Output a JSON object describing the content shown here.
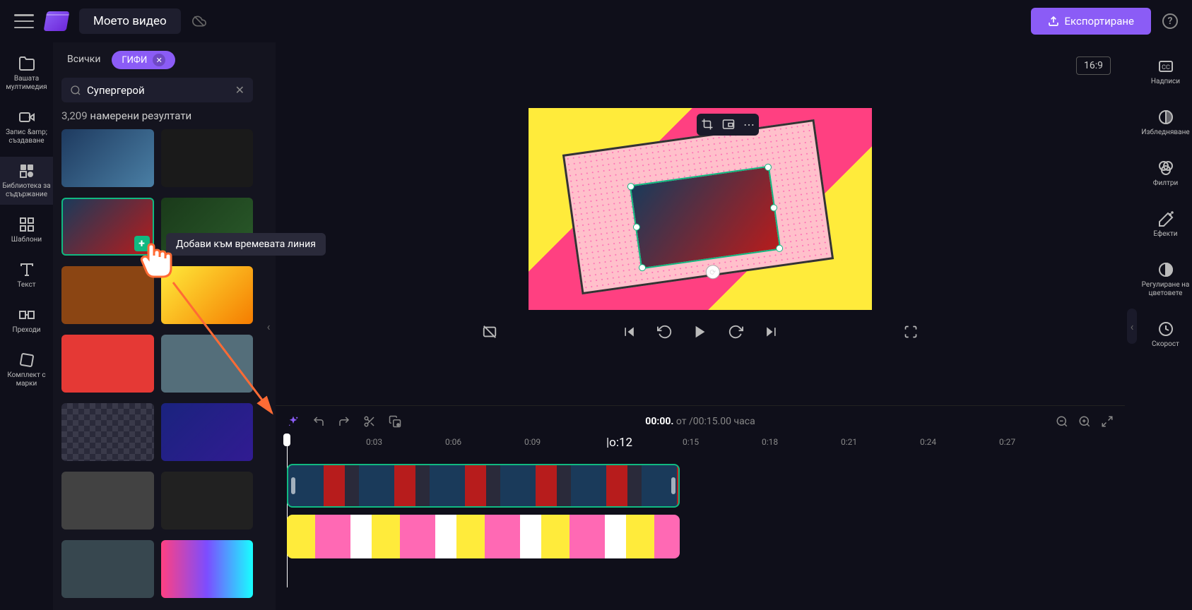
{
  "header": {
    "project_title": "Моето видео",
    "export_label": "Експортиране",
    "aspect_ratio": "16:9"
  },
  "left_nav": {
    "items": [
      {
        "icon": "folder",
        "label": "Вашата мултимедия"
      },
      {
        "icon": "camera",
        "label": "Запис &amp; създаване"
      },
      {
        "icon": "library",
        "label": "Библиотека за съдържание"
      },
      {
        "icon": "templates",
        "label": "Шаблони"
      },
      {
        "icon": "text",
        "label": "Текст"
      },
      {
        "icon": "transitions",
        "label": "Преходи"
      },
      {
        "icon": "brand",
        "label": "Комплект с марки"
      }
    ]
  },
  "content_panel": {
    "tab_all": "Всички",
    "tab_gifs": "ГИФИ",
    "search_value": "Супергерой",
    "results_count": "3,209",
    "results_label": "намерени резултати",
    "tooltip": "Добави към времевата линия"
  },
  "right_nav": {
    "items": [
      {
        "icon": "cc",
        "label": "Надписи"
      },
      {
        "icon": "fade",
        "label": "Избледняване"
      },
      {
        "icon": "filters",
        "label": "Филтри"
      },
      {
        "icon": "effects",
        "label": "Ефекти"
      },
      {
        "icon": "colors",
        "label": "Регулиране на цветовете"
      },
      {
        "icon": "speed",
        "label": "Скорост"
      }
    ]
  },
  "timeline": {
    "current_time": "00:00.",
    "total_label": "от /00:15.00 часа",
    "ruler_marks": [
      "0:03",
      "0:06",
      "0:09",
      "0:15",
      "0:18",
      "0:21",
      "0:24",
      "0:27"
    ],
    "ruler_highlight": "|o:12"
  }
}
